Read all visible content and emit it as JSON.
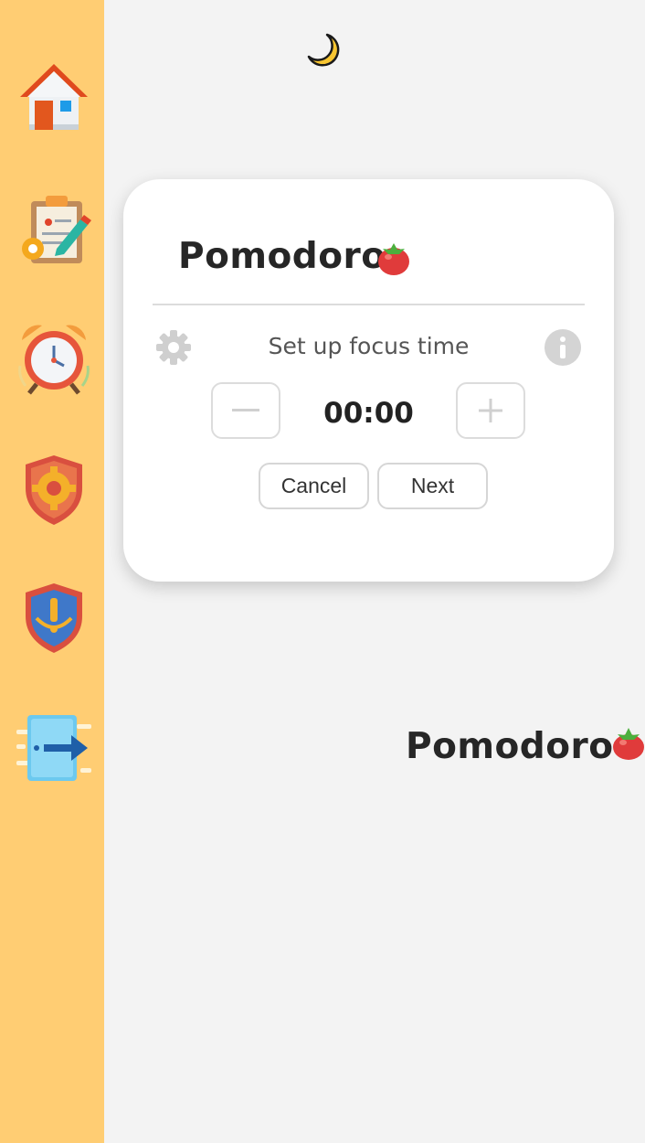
{
  "sidebar": {
    "items": [
      {
        "name": "home",
        "icon": "home-icon"
      },
      {
        "name": "tasks",
        "icon": "task-list-icon"
      },
      {
        "name": "pomodoro",
        "icon": "alarm-clock-icon"
      },
      {
        "name": "settings",
        "icon": "shield-gear-icon"
      },
      {
        "name": "alerts",
        "icon": "shield-alert-icon"
      },
      {
        "name": "logout",
        "icon": "exit-icon"
      }
    ],
    "color": "#ffcd73"
  },
  "theme_toggle": {
    "icon": "moon-icon"
  },
  "modal": {
    "title": "Pomodoro",
    "title_icon": "tomato-icon",
    "setup_label": "Set up focus time",
    "time": "00:00",
    "minus_icon": "minus-icon",
    "plus_icon": "plus-icon",
    "cancel_label": "Cancel",
    "next_label": "Next",
    "settings_icon": "gear-icon",
    "info_icon": "info-icon"
  },
  "background_title": {
    "title": "Pomodoro",
    "icon": "tomato-icon"
  }
}
